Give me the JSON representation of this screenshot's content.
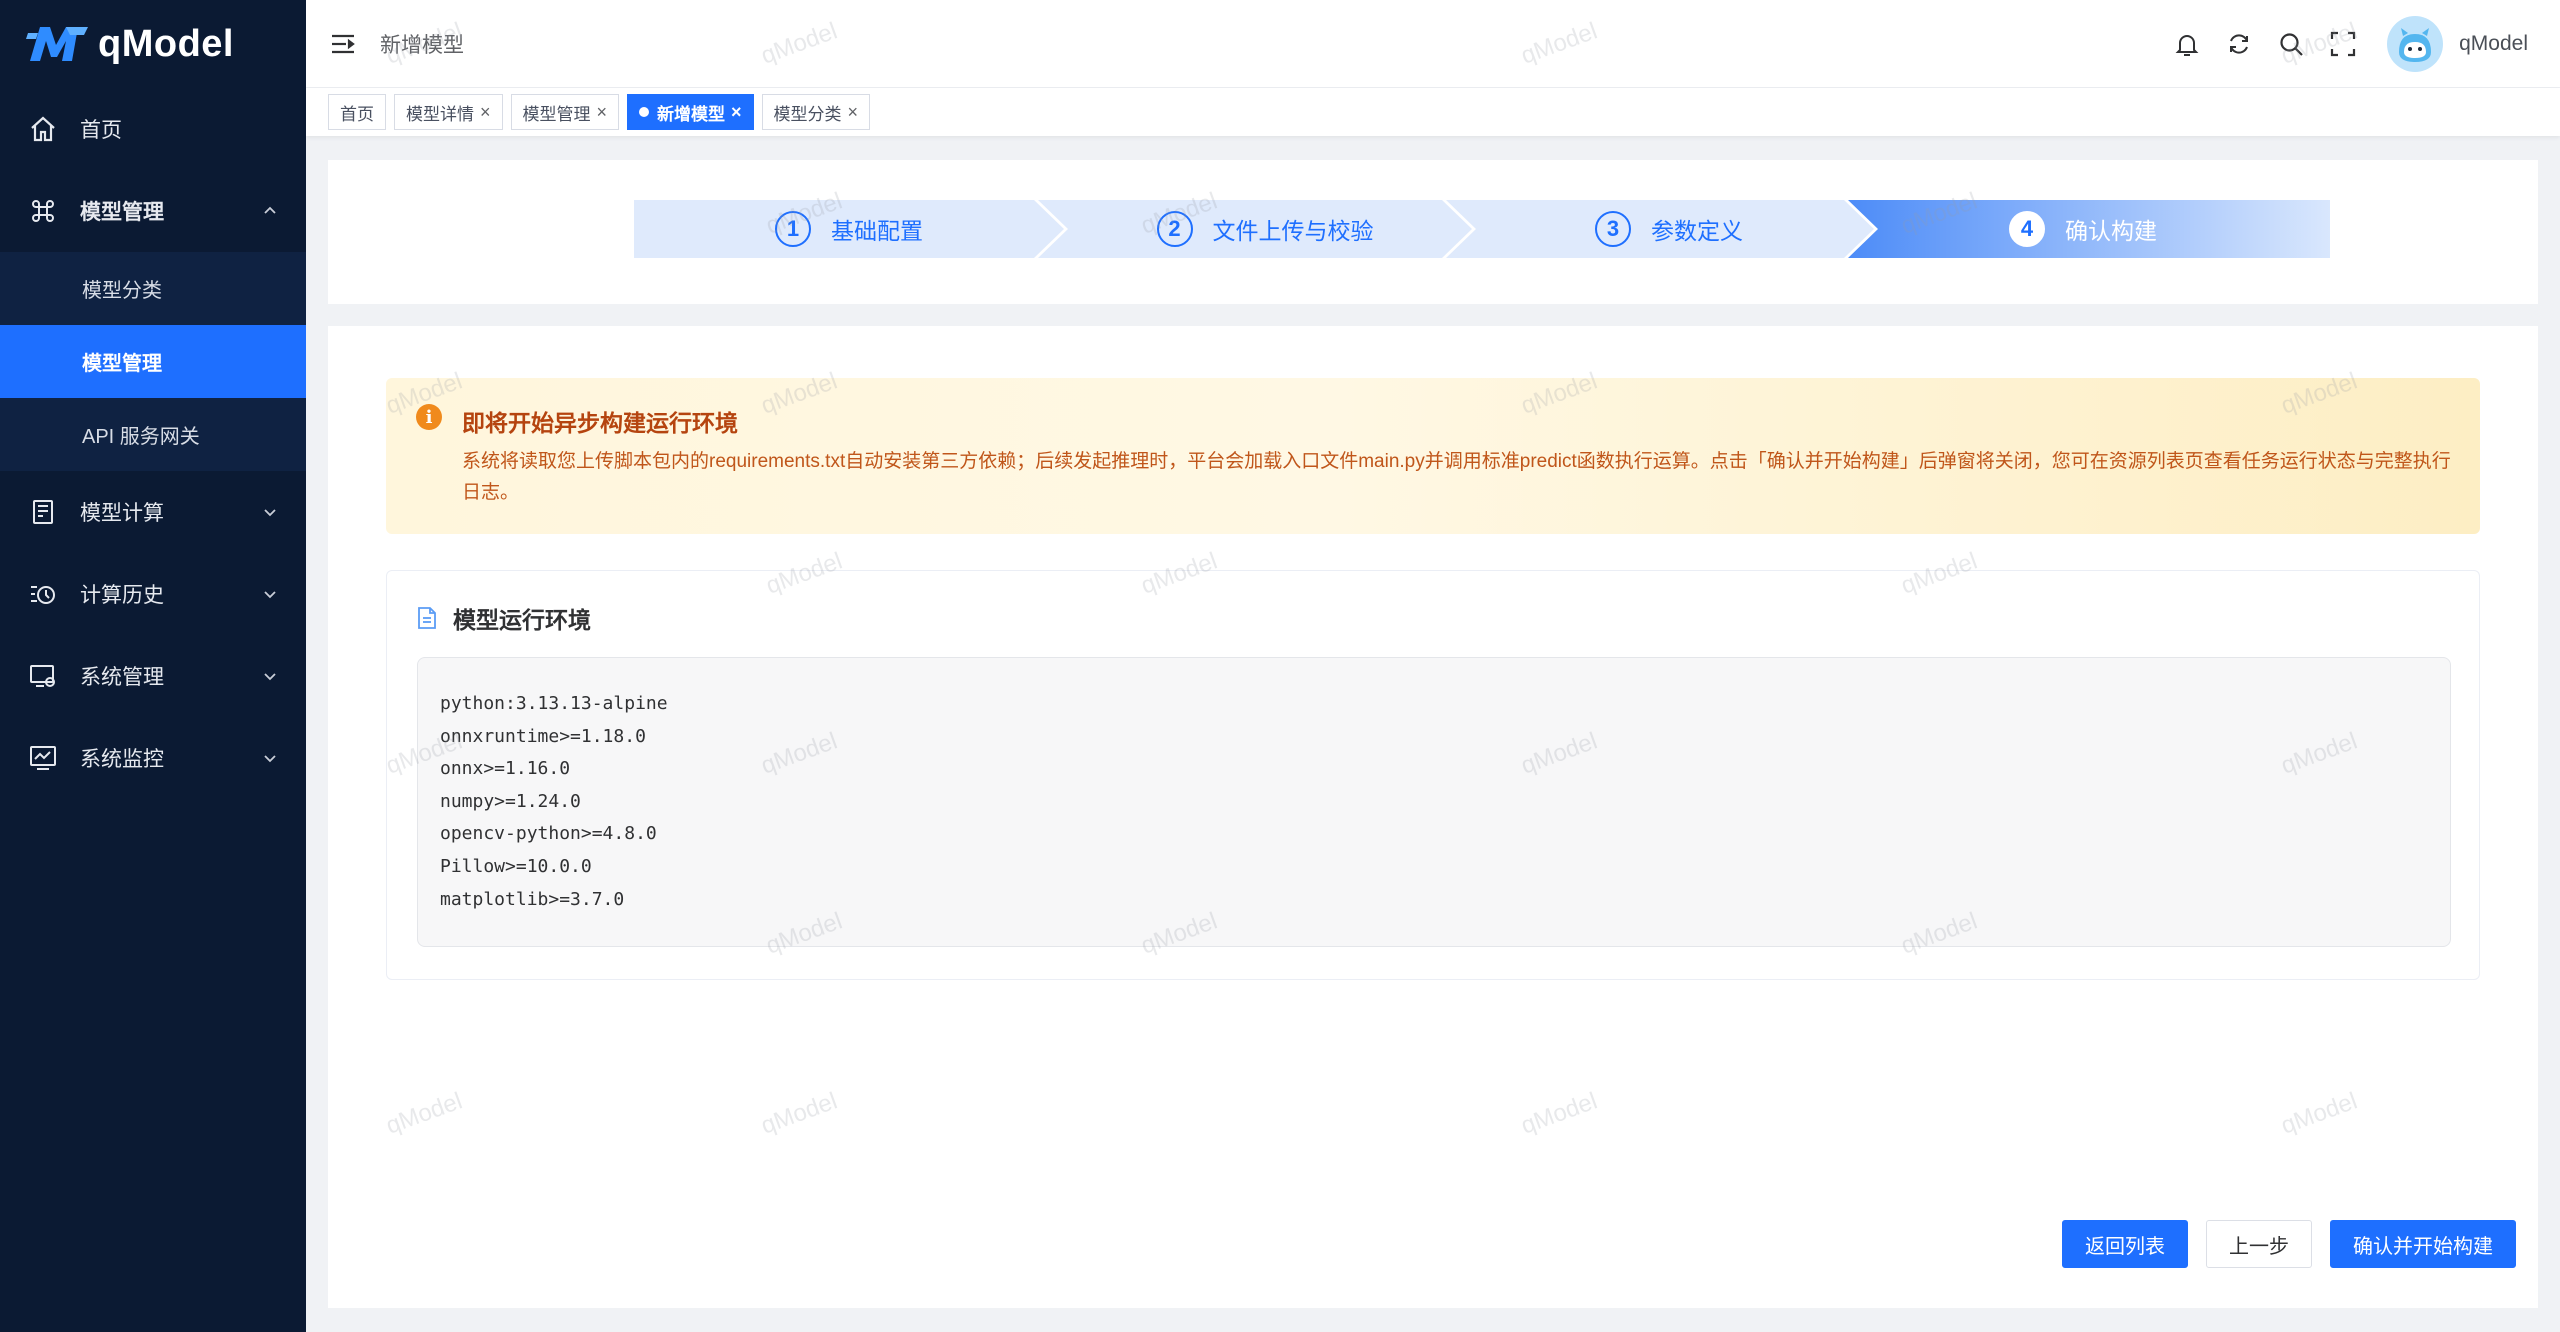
{
  "brand": {
    "name": "qModel"
  },
  "sidebar": {
    "items": [
      {
        "label": "首页",
        "icon": "home-icon"
      },
      {
        "label": "模型管理",
        "icon": "command-icon",
        "open": true,
        "children": [
          {
            "label": "模型分类"
          },
          {
            "label": "模型管理",
            "active": true
          },
          {
            "label": "API 服务网关"
          }
        ]
      },
      {
        "label": "模型计算",
        "icon": "calculator-icon"
      },
      {
        "label": "计算历史",
        "icon": "history-icon"
      },
      {
        "label": "系统管理",
        "icon": "system-settings-icon"
      },
      {
        "label": "系统监控",
        "icon": "monitor-chart-icon"
      }
    ]
  },
  "header": {
    "breadcrumb": "新增模型",
    "username": "qModel"
  },
  "tabs": [
    {
      "label": "首页"
    },
    {
      "label": "模型详情"
    },
    {
      "label": "模型管理"
    },
    {
      "label": "新增模型",
      "active": true
    },
    {
      "label": "模型分类"
    }
  ],
  "steps": [
    {
      "num": "1",
      "label": "基础配置"
    },
    {
      "num": "2",
      "label": "文件上传与校验"
    },
    {
      "num": "3",
      "label": "参数定义"
    },
    {
      "num": "4",
      "label": "确认构建",
      "current": true
    }
  ],
  "alert": {
    "title": "即将开始异步构建运行环境",
    "text": "系统将读取您上传脚本包内的requirements.txt自动安装第三方依赖；后续发起推理时，平台会加载入口文件main.py并调用标准predict函数执行运算。点击「确认并开始构建」后弹窗将关闭，您可在资源列表页查看任务运行状态与完整执行日志。"
  },
  "environment": {
    "title": "模型运行环境",
    "lines": [
      "python:3.13.13-alpine",
      "onnxruntime>=1.18.0",
      "onnx>=1.16.0",
      "numpy>=1.24.0",
      "opencv-python>=4.8.0",
      "Pillow>=10.0.0",
      "matplotlib>=3.7.0"
    ]
  },
  "buttons": {
    "back_to_list": "返回列表",
    "previous": "上一步",
    "confirm": "确认并开始构建"
  },
  "watermark": "qModel",
  "colors": {
    "sidebar_bg": "#0b1a33",
    "primary": "#1e6fff",
    "alert_title": "#b5440f",
    "alert_text": "#c0561a"
  }
}
